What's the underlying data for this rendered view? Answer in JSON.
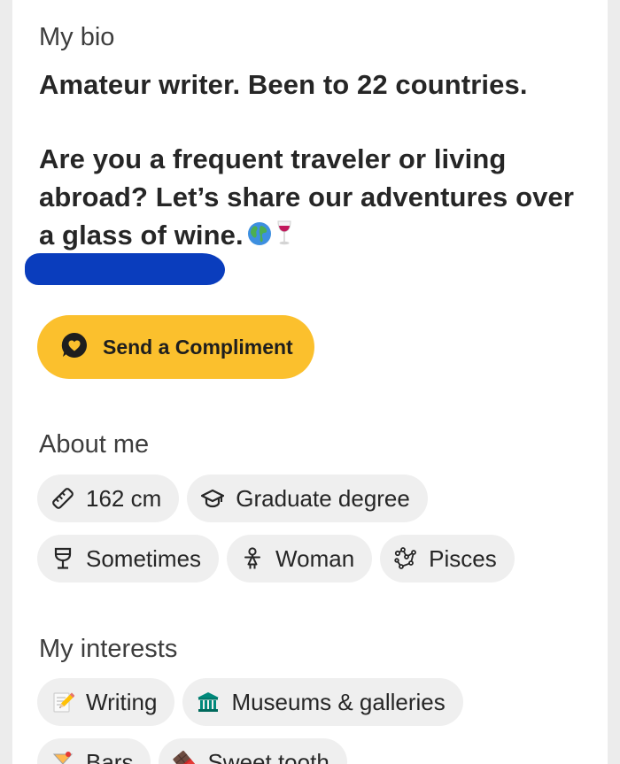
{
  "bio": {
    "title": "My bio",
    "line1": "Amateur writer. Been to 22 countries.",
    "line2": "Are you a frequent traveler or living abroad? Let’s share our adventures over a glass of wine.",
    "emoji": [
      "globe-emoji",
      "wine-glass-emoji"
    ]
  },
  "compliment": {
    "label": "Send a Compliment",
    "icon": "heart-speech-bubble-icon",
    "color": "#fbc02d"
  },
  "about": {
    "title": "About me",
    "chips": [
      {
        "label": "162 cm",
        "icon": "ruler-icon"
      },
      {
        "label": "Graduate degree",
        "icon": "graduation-cap-icon"
      },
      {
        "label": "Sometimes",
        "icon": "wine-glass-icon"
      },
      {
        "label": "Woman",
        "icon": "woman-icon"
      },
      {
        "label": "Pisces",
        "icon": "constellation-icon"
      }
    ]
  },
  "interests": {
    "title": "My interests",
    "chips": [
      {
        "label": "Writing",
        "icon": "pencil-emoji"
      },
      {
        "label": "Museums & galleries",
        "icon": "museum-emoji"
      },
      {
        "label": "Bars",
        "icon": "cocktail-emoji"
      },
      {
        "label": "Sweet tooth",
        "icon": "chocolate-emoji"
      }
    ]
  }
}
